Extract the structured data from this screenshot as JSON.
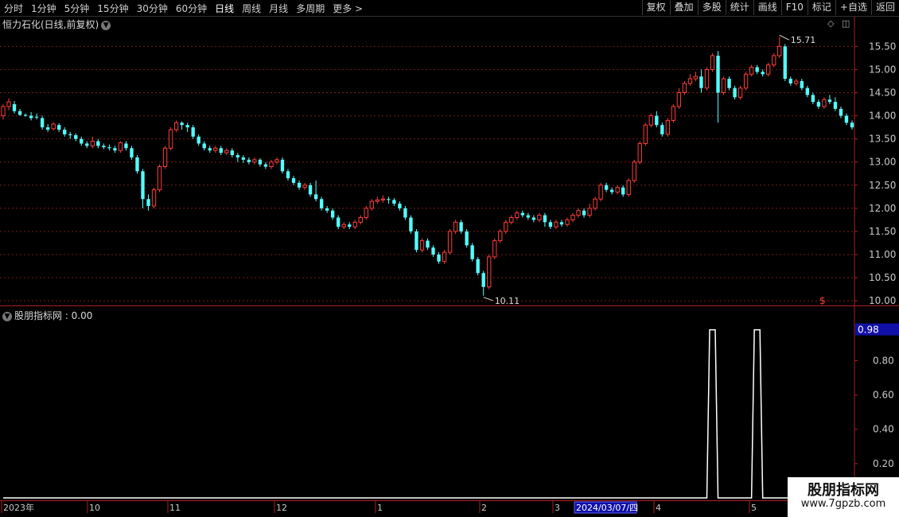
{
  "toolbar": {
    "periods": [
      "分时",
      "1分钟",
      "5分钟",
      "15分钟",
      "30分钟",
      "60分钟",
      "日线",
      "周线",
      "月线",
      "多周期",
      "更多 >"
    ],
    "active_period": "日线",
    "actions": [
      "复权",
      "叠加",
      "多股",
      "统计",
      "画线",
      "F10",
      "标记",
      "+自选",
      "返回"
    ]
  },
  "main_chart": {
    "title": "恒力石化(日线,前复权)",
    "y_ticks": [
      "15.50",
      "15.00",
      "14.50",
      "14.00",
      "13.50",
      "13.00",
      "12.50",
      "12.00",
      "11.50",
      "11.00",
      "10.50",
      "10.00"
    ],
    "high_label": "15.71",
    "low_label": "10.11",
    "marker_symbol": "$"
  },
  "indicator": {
    "title": "股朋指标网 : 0.00",
    "current_value": "0.98",
    "y_ticks": [
      "0.80",
      "0.60",
      "0.40",
      "0.20"
    ]
  },
  "x_axis": {
    "labels": [
      "2023年",
      "10",
      "11",
      "12",
      "1",
      "2",
      "3",
      "4",
      "5"
    ],
    "cursor_date": "2024/03/07/四"
  },
  "watermark": {
    "line1": "股朋指标网",
    "line2": "www.7gpzb.com"
  },
  "colors": {
    "up": "#ff3c3c",
    "down": "#54ffff",
    "grid": "#7a1a1a",
    "frame": "#b01e1e",
    "indicator_line": "#ffffff"
  },
  "chart_data": [
    {
      "type": "candlestick",
      "title": "恒力石化(日线,前复权)",
      "ylim": [
        9.9,
        15.85
      ],
      "max_label": 15.71,
      "min_label": 10.11,
      "ohlc": [
        [
          14.0,
          14.2,
          14.05,
          14.25,
          13.92
        ],
        [
          14.2,
          14.3,
          14.15,
          14.38,
          14.12
        ],
        [
          14.25,
          14.1,
          14.05,
          14.32
        ],
        [
          14.1,
          14.02,
          14.0,
          14.15
        ],
        [
          14.02,
          14.0,
          13.98,
          14.05
        ],
        [
          14.0,
          13.95,
          13.9,
          14.08
        ],
        [
          13.98,
          13.97,
          13.92,
          14.05
        ],
        [
          13.95,
          13.75,
          13.7,
          14.0
        ],
        [
          13.75,
          13.7,
          13.65,
          13.82
        ],
        [
          13.72,
          13.82,
          13.68,
          13.86
        ],
        [
          13.8,
          13.7,
          13.65,
          13.84
        ],
        [
          13.7,
          13.6,
          13.55,
          13.75
        ],
        [
          13.6,
          13.58,
          13.5,
          13.65
        ],
        [
          13.58,
          13.5,
          13.45,
          13.62
        ],
        [
          13.5,
          13.4,
          13.35,
          13.55
        ],
        [
          13.4,
          13.35,
          13.3,
          13.45
        ],
        [
          13.35,
          13.45,
          13.3,
          13.55
        ],
        [
          13.45,
          13.35,
          13.3,
          13.5
        ],
        [
          13.35,
          13.32,
          13.28,
          13.4
        ],
        [
          13.32,
          13.3,
          13.25,
          13.38
        ],
        [
          13.3,
          13.25,
          13.2,
          13.35
        ],
        [
          13.25,
          13.42,
          13.2,
          13.45
        ],
        [
          13.4,
          13.3,
          13.25,
          13.45
        ],
        [
          13.3,
          13.1,
          13.05,
          13.35
        ],
        [
          13.1,
          12.8,
          12.75,
          13.15
        ],
        [
          12.8,
          12.2,
          12.0,
          12.85
        ],
        [
          12.2,
          12.05,
          11.95,
          12.3
        ],
        [
          12.05,
          12.4,
          12.0,
          12.45
        ],
        [
          12.4,
          12.9,
          12.35,
          12.95
        ],
        [
          12.9,
          13.3,
          12.85,
          13.35
        ],
        [
          13.3,
          13.7,
          13.25,
          13.75
        ],
        [
          13.7,
          13.85,
          13.65,
          13.9
        ],
        [
          13.85,
          13.8,
          13.7,
          13.88
        ],
        [
          13.8,
          13.75,
          13.65,
          13.85
        ],
        [
          13.75,
          13.55,
          13.5,
          13.8
        ],
        [
          13.55,
          13.4,
          13.35,
          13.6
        ],
        [
          13.4,
          13.3,
          13.25,
          13.45
        ],
        [
          13.3,
          13.25,
          13.2,
          13.35
        ],
        [
          13.25,
          13.3,
          13.2,
          13.35
        ],
        [
          13.3,
          13.2,
          13.15,
          13.35
        ],
        [
          13.2,
          13.25,
          13.15,
          13.3
        ],
        [
          13.25,
          13.15,
          13.1,
          13.3
        ],
        [
          13.15,
          13.1,
          13.0,
          13.2
        ],
        [
          13.1,
          13.05,
          12.98,
          13.15
        ],
        [
          13.05,
          13.0,
          12.95,
          13.1
        ],
        [
          13.0,
          13.05,
          12.95,
          13.1
        ],
        [
          13.05,
          12.95,
          12.9,
          13.08
        ],
        [
          12.95,
          12.9,
          12.85,
          13.0
        ],
        [
          12.9,
          13.0,
          12.85,
          13.05
        ],
        [
          13.0,
          13.05,
          12.95,
          13.1
        ],
        [
          13.05,
          12.8,
          12.75,
          13.1
        ],
        [
          12.8,
          12.65,
          12.6,
          12.85
        ],
        [
          12.65,
          12.55,
          12.5,
          12.7
        ],
        [
          12.55,
          12.45,
          12.4,
          12.6
        ],
        [
          12.45,
          12.5,
          12.4,
          12.55
        ],
        [
          12.5,
          12.3,
          12.25,
          12.55
        ],
        [
          12.3,
          12.2,
          12.15,
          12.6
        ],
        [
          12.2,
          12.0,
          11.95,
          12.25
        ],
        [
          12.0,
          11.95,
          11.9,
          12.05
        ],
        [
          11.95,
          11.8,
          11.75,
          12.0
        ],
        [
          11.8,
          11.6,
          11.55,
          11.85
        ],
        [
          11.6,
          11.65,
          11.55,
          11.7
        ],
        [
          11.65,
          11.6,
          11.55,
          11.7
        ],
        [
          11.6,
          11.7,
          11.55,
          11.75
        ],
        [
          11.7,
          11.8,
          11.65,
          11.85
        ],
        [
          11.8,
          12.0,
          11.75,
          12.05
        ],
        [
          12.0,
          12.15,
          11.95,
          12.2
        ],
        [
          12.15,
          12.18,
          12.1,
          12.25
        ],
        [
          12.18,
          12.2,
          12.12,
          12.28
        ],
        [
          12.2,
          12.18,
          12.1,
          12.25
        ],
        [
          12.18,
          12.1,
          12.05,
          12.22
        ],
        [
          12.1,
          12.0,
          11.95,
          12.15
        ],
        [
          12.0,
          11.8,
          11.75,
          12.05
        ],
        [
          11.8,
          11.5,
          11.45,
          11.85
        ],
        [
          11.5,
          11.1,
          11.05,
          11.55
        ],
        [
          11.1,
          11.3,
          11.05,
          11.35
        ],
        [
          11.3,
          11.15,
          11.1,
          11.35
        ],
        [
          11.15,
          11.0,
          10.95,
          11.2
        ],
        [
          11.0,
          10.85,
          10.8,
          11.05
        ],
        [
          10.85,
          11.05,
          10.8,
          11.1
        ],
        [
          11.05,
          11.5,
          11.0,
          11.55
        ],
        [
          11.5,
          11.7,
          11.45,
          11.75
        ],
        [
          11.7,
          11.5,
          11.45,
          11.75
        ],
        [
          11.5,
          11.2,
          11.15,
          11.55
        ],
        [
          11.2,
          10.9,
          10.85,
          11.25
        ],
        [
          10.9,
          10.6,
          10.55,
          10.95
        ],
        [
          10.6,
          10.3,
          10.11,
          10.65
        ],
        [
          10.3,
          10.95,
          10.25,
          11.0
        ],
        [
          10.95,
          11.3,
          10.9,
          11.35
        ],
        [
          11.3,
          11.5,
          11.25,
          11.55
        ],
        [
          11.5,
          11.7,
          11.45,
          11.75
        ],
        [
          11.7,
          11.8,
          11.65,
          11.85
        ],
        [
          11.8,
          11.9,
          11.75,
          11.95
        ],
        [
          11.9,
          11.85,
          11.8,
          11.95
        ],
        [
          11.85,
          11.8,
          11.75,
          11.9
        ],
        [
          11.8,
          11.75,
          11.7,
          11.85
        ],
        [
          11.75,
          11.85,
          11.7,
          11.9
        ],
        [
          11.85,
          11.7,
          11.6,
          11.9
        ],
        [
          11.7,
          11.6,
          11.55,
          11.75
        ],
        [
          11.6,
          11.7,
          11.55,
          11.75
        ],
        [
          11.7,
          11.65,
          11.6,
          11.75
        ],
        [
          11.65,
          11.75,
          11.6,
          11.8
        ],
        [
          11.75,
          11.85,
          11.7,
          11.9
        ],
        [
          11.85,
          11.95,
          11.8,
          12.0
        ],
        [
          11.95,
          11.85,
          11.8,
          12.0
        ],
        [
          11.85,
          12.0,
          11.8,
          12.1
        ],
        [
          12.0,
          12.2,
          11.95,
          12.25
        ],
        [
          12.2,
          12.5,
          12.15,
          12.55
        ],
        [
          12.5,
          12.4,
          12.35,
          12.55
        ],
        [
          12.4,
          12.35,
          12.3,
          12.45
        ],
        [
          12.35,
          12.45,
          12.3,
          12.5
        ],
        [
          12.45,
          12.3,
          12.25,
          12.5
        ],
        [
          12.3,
          12.6,
          12.25,
          12.65
        ],
        [
          12.6,
          13.0,
          12.55,
          13.05
        ],
        [
          13.0,
          13.4,
          12.95,
          13.45
        ],
        [
          13.4,
          13.8,
          13.35,
          13.85
        ],
        [
          13.8,
          14.0,
          13.75,
          14.05
        ],
        [
          14.0,
          13.8,
          13.75,
          14.1
        ],
        [
          13.8,
          13.6,
          13.55,
          13.85
        ],
        [
          13.6,
          13.9,
          13.55,
          13.95
        ],
        [
          13.9,
          14.2,
          13.85,
          14.25
        ],
        [
          14.2,
          14.5,
          14.15,
          14.6
        ],
        [
          14.5,
          14.7,
          14.45,
          14.75
        ],
        [
          14.7,
          14.8,
          14.65,
          14.9
        ],
        [
          14.8,
          14.85,
          14.75,
          14.95
        ],
        [
          14.85,
          14.6,
          14.5,
          15.0
        ],
        [
          14.6,
          15.0,
          14.55,
          15.05
        ],
        [
          15.0,
          15.3,
          14.95,
          15.35
        ],
        [
          15.3,
          14.5,
          13.85,
          15.4
        ],
        [
          14.5,
          14.8,
          14.45,
          14.85
        ],
        [
          14.8,
          14.6,
          14.55,
          14.85
        ],
        [
          14.6,
          14.4,
          14.35,
          14.65
        ],
        [
          14.4,
          14.6,
          14.35,
          14.65
        ],
        [
          14.6,
          14.9,
          14.55,
          14.95
        ],
        [
          14.9,
          15.05,
          14.85,
          15.1
        ],
        [
          15.05,
          14.95,
          14.9,
          15.1
        ],
        [
          14.95,
          14.9,
          14.85,
          15.0
        ],
        [
          14.9,
          15.1,
          14.85,
          15.15
        ],
        [
          15.1,
          15.3,
          15.05,
          15.35
        ],
        [
          15.3,
          15.5,
          15.25,
          15.71
        ],
        [
          15.5,
          14.8,
          14.75,
          15.55
        ],
        [
          14.8,
          14.7,
          14.65,
          14.85
        ],
        [
          14.7,
          14.75,
          14.65,
          14.8
        ],
        [
          14.75,
          14.6,
          14.55,
          14.8
        ],
        [
          14.6,
          14.45,
          14.4,
          14.65
        ],
        [
          14.45,
          14.3,
          14.25,
          14.5
        ],
        [
          14.3,
          14.2,
          14.15,
          14.35
        ],
        [
          14.2,
          14.35,
          14.15,
          14.4
        ],
        [
          14.35,
          14.3,
          14.25,
          14.45
        ],
        [
          14.3,
          14.15,
          14.1,
          14.4
        ],
        [
          14.15,
          14.0,
          13.95,
          14.2
        ],
        [
          14.0,
          13.85,
          13.8,
          14.05
        ],
        [
          13.85,
          13.75,
          13.7,
          13.9
        ]
      ]
    },
    {
      "type": "line",
      "title": "股朋指标网",
      "ylim": [
        0,
        1.02
      ],
      "y_ticks": [
        0.2,
        0.4,
        0.6,
        0.8
      ],
      "spikes": [
        {
          "index": 127,
          "value": 0.98
        },
        {
          "index": 135,
          "value": 0.98
        }
      ],
      "baseline": 0
    }
  ]
}
